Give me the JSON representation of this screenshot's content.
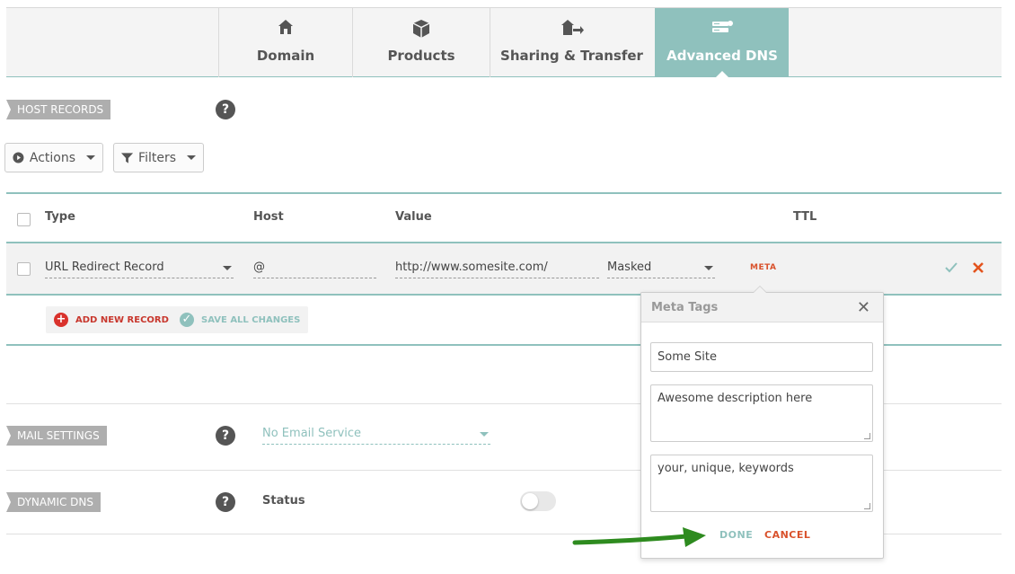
{
  "tabs": [
    {
      "label": "Domain",
      "icon": "home-icon"
    },
    {
      "label": "Products",
      "icon": "box-icon"
    },
    {
      "label": "Sharing & Transfer",
      "icon": "home-transfer-icon"
    },
    {
      "label": "Advanced DNS",
      "icon": "server-icon",
      "active": true
    }
  ],
  "host_records": {
    "tag": "HOST RECORDS",
    "help": "?",
    "actions_label": "Actions",
    "filters_label": "Filters",
    "columns": {
      "type": "Type",
      "host": "Host",
      "value": "Value",
      "ttl": "TTL"
    },
    "row": {
      "type": "URL Redirect Record",
      "host": "@",
      "value": "http://www.somesite.com/",
      "redirect_mode": "Masked",
      "meta_link": "META"
    },
    "add_new_label": "ADD NEW RECORD",
    "save_all_label": "SAVE ALL CHANGES"
  },
  "mail": {
    "tag": "MAIL SETTINGS",
    "help": "?",
    "selected": "No Email Service"
  },
  "dynamic_dns": {
    "tag": "DYNAMIC DNS",
    "help": "?",
    "status_label": "Status",
    "enabled": false
  },
  "meta_popover": {
    "title": "Meta Tags",
    "close": "✕",
    "site_title": "Some Site",
    "description": "Awesome description here",
    "keywords": "your, unique, keywords",
    "done_label": "DONE",
    "cancel_label": "CANCEL"
  },
  "colors": {
    "accent": "#8fc1bd",
    "danger": "#d9522c",
    "arrow": "#2e8b1f"
  }
}
